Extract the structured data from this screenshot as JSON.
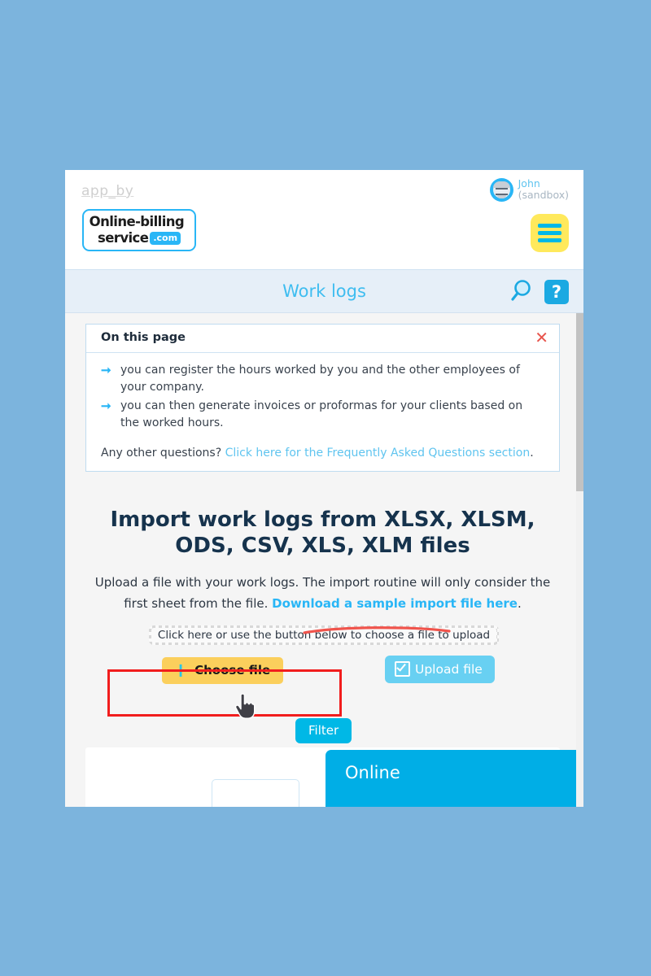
{
  "theme": {
    "page_background": "#7cb4dd",
    "brand_blue": "#29b6f6",
    "title_bar_background": "#e6eff8",
    "accent_yellow": "#fbcf5c",
    "accent_cyan": "#00b8e6",
    "annotation_red": "#f11d1d",
    "close_red": "#e8554d",
    "heading_navy": "#16334d"
  },
  "brand": {
    "app_by_label": "app_by",
    "logo_line1": "Online-billing-",
    "logo_line2": "service",
    "logo_com": ".com",
    "menu_icon": "hamburger-menu-icon"
  },
  "user": {
    "name": "John",
    "environment": "(sandbox)",
    "avatar_icon": "user-avatar-icon"
  },
  "title_bar": {
    "title": "Work logs",
    "search_icon": "search-icon",
    "help_label": "?"
  },
  "info_panel": {
    "heading": "On this page",
    "close_icon": "close-icon",
    "bullets": [
      "you can register the hours worked by you and the other employees of your company.",
      "you can then generate invoices or proformas for your clients based on the worked hours."
    ],
    "faq_prefix": "Any other questions? ",
    "faq_link": "Click here for the Frequently Asked Questions section",
    "faq_suffix": "."
  },
  "import": {
    "heading": "Import work logs from XLSX, XLSM, ODS, CSV, XLS, XLM files",
    "description_prefix": "Upload a file with your work logs. The import routine will only consider the first sheet from the file. ",
    "description_link": "Download a sample import file here",
    "description_suffix": ".",
    "dropzone_text": "Click here or use the button below to choose a file to upload",
    "choose_file_label": "Choose file",
    "choose_file_icon": "plus-icon",
    "upload_file_label": "Upload file",
    "upload_file_icon": "checkbox-check-icon"
  },
  "lower": {
    "filter_label": "Filter",
    "online_label": "Online"
  },
  "annotations": {
    "underline": "red-underline-annotation",
    "rectangle": "red-rectangle-annotation",
    "cursor": "hand-cursor-pointer"
  }
}
